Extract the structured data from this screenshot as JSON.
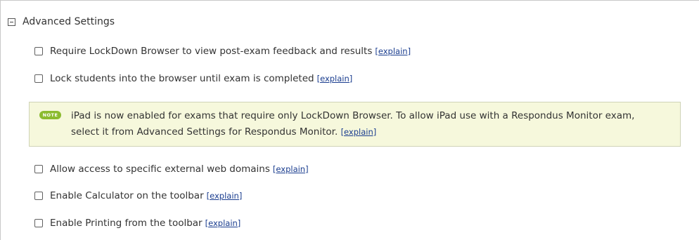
{
  "section": {
    "title": "Advanced Settings",
    "collapse_icon": "minus-box-icon"
  },
  "options_top": [
    {
      "label": "Require LockDown Browser to view post-exam feedback and results",
      "link": "[explain]",
      "checked": false
    },
    {
      "label": "Lock students into the browser until exam is completed",
      "link": "[explain]",
      "checked": false
    }
  ],
  "note": {
    "badge": "NOTE",
    "text": "iPad is now enabled for exams that require only LockDown Browser. To allow iPad use with a Respondus Monitor exam, select it from Advanced Settings for Respondus Monitor.",
    "link": "[explain]",
    "badge_color": "#8bbb2f",
    "background_color": "#f6f8dc"
  },
  "options_bottom": [
    {
      "label": "Allow access to specific external web domains",
      "link": "[explain]",
      "checked": false
    },
    {
      "label": "Enable Calculator on the toolbar",
      "link": "[explain]",
      "checked": false
    },
    {
      "label": "Enable Printing from the toolbar",
      "link": "[explain]",
      "checked": false
    }
  ],
  "colors": {
    "link": "#1a3d8f",
    "text": "#333333"
  }
}
